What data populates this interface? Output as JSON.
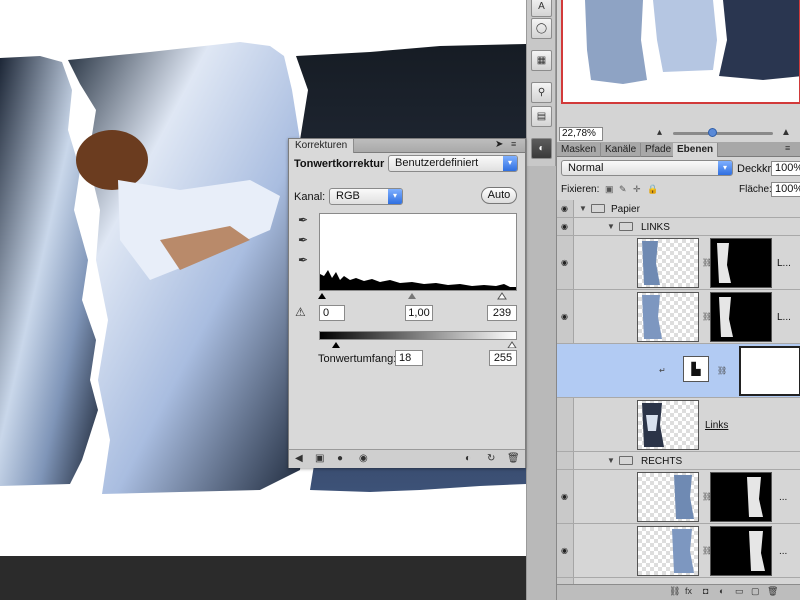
{
  "navigator": {
    "zoom": "22,78%"
  },
  "layers_panel": {
    "tabs": [
      {
        "label": "Masken",
        "active": false
      },
      {
        "label": "Kanäle",
        "active": false
      },
      {
        "label": "Pfade",
        "active": false
      },
      {
        "label": "Ebenen",
        "active": true
      }
    ],
    "blend_mode": "Normal",
    "opacity_label": "Deckkraft:",
    "opacity_value": "100%",
    "lock_label": "Fixieren:",
    "fill_label": "Fläche:",
    "fill_value": "100%",
    "layers": [
      {
        "type": "group",
        "name": "Papier"
      },
      {
        "type": "group",
        "name": "LINKS"
      },
      {
        "type": "layer",
        "name": "L..."
      },
      {
        "type": "layer",
        "name": "L..."
      },
      {
        "type": "adjustment",
        "name": ""
      },
      {
        "type": "layer",
        "name": "Links"
      },
      {
        "type": "group",
        "name": "RECHTS"
      },
      {
        "type": "layer",
        "name": "..."
      },
      {
        "type": "layer",
        "name": "..."
      }
    ]
  },
  "korrekturen": {
    "tab": "Korrekturen",
    "title": "Tonwertkorrektur",
    "preset": "Benutzerdefiniert",
    "channel_label": "Kanal:",
    "channel": "RGB",
    "auto_label": "Auto",
    "input_black": "0",
    "input_gamma": "1,00",
    "input_white": "239",
    "output_label": "Tonwertumfang:",
    "output_black": "18",
    "output_white": "255"
  },
  "colors": {
    "panel_bg": "#d6d6d6",
    "selected_layer": "#b2cbf3",
    "navigator_frame": "#d23a3a",
    "accent_blue": "#2f6fe0"
  }
}
